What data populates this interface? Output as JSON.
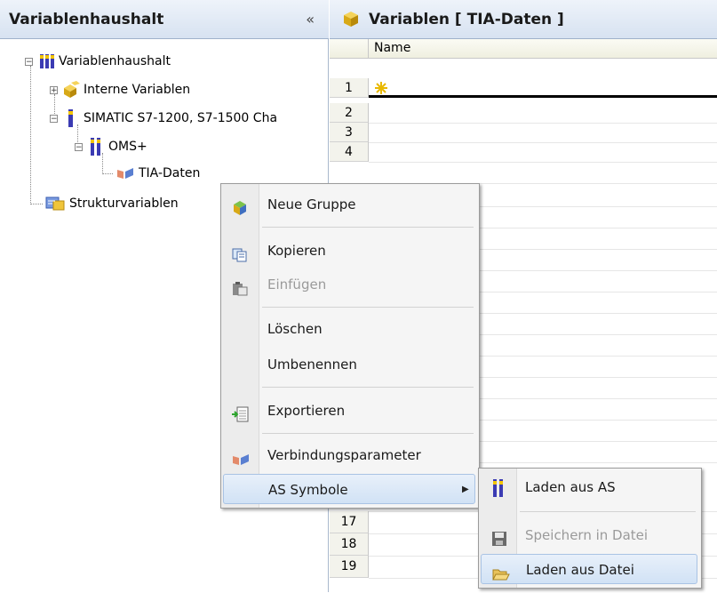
{
  "left_panel": {
    "title": "Variablenhaushalt",
    "collapse_glyph": "«",
    "tree": [
      {
        "label": "Variablenhaushalt",
        "icon": "variable-root-icon",
        "expander": "−"
      },
      {
        "label": "Interne Variablen",
        "icon": "cube-group-icon",
        "expander": "+"
      },
      {
        "label": "SIMATIC S7-1200, S7-1500 Cha",
        "icon": "plc-single-icon",
        "expander": "−"
      },
      {
        "label": "OMS+",
        "icon": "plc-double-icon",
        "expander": "−"
      },
      {
        "label": "TIA-Daten",
        "icon": "connection-icon",
        "expander": ""
      },
      {
        "label": "Strukturvariablen",
        "icon": "struct-icon",
        "expander": ""
      }
    ]
  },
  "right_panel": {
    "title": "Variablen [ TIA-Daten ]",
    "column_name": "Name",
    "row_numbers_top": [
      "1",
      "2",
      "3",
      "4"
    ],
    "row_numbers_bottom": [
      "17",
      "18",
      "19"
    ]
  },
  "context_menu": {
    "items": [
      {
        "label": "Neue Gruppe",
        "icon": "new-group-icon",
        "enabled": true
      },
      {
        "label": "Kopieren",
        "icon": "copy-icon",
        "enabled": true
      },
      {
        "label": "Einfügen",
        "icon": "paste-icon",
        "enabled": false
      },
      {
        "label": "Löschen",
        "icon": "",
        "enabled": true
      },
      {
        "label": "Umbenennen",
        "icon": "",
        "enabled": true
      },
      {
        "label": "Exportieren",
        "icon": "export-icon",
        "enabled": true
      },
      {
        "label": "Verbindungsparameter",
        "icon": "connection-icon",
        "enabled": true
      },
      {
        "label": "AS Symbole",
        "icon": "",
        "enabled": true,
        "has_submenu": true,
        "highlighted": true
      }
    ]
  },
  "submenu": {
    "items": [
      {
        "label": "Laden aus AS",
        "icon": "plc-double-icon",
        "enabled": true
      },
      {
        "label": "Speichern in Datei",
        "icon": "save-icon",
        "enabled": false
      },
      {
        "label": "Laden aus Datei",
        "icon": "open-folder-icon",
        "enabled": true,
        "highlighted": true
      }
    ]
  },
  "colors": {
    "header_gradient_top": "#eef3fa",
    "header_gradient_bottom": "#d7e2f1",
    "highlight": "#d1e2f5",
    "disabled_text": "#9a9a9a"
  }
}
